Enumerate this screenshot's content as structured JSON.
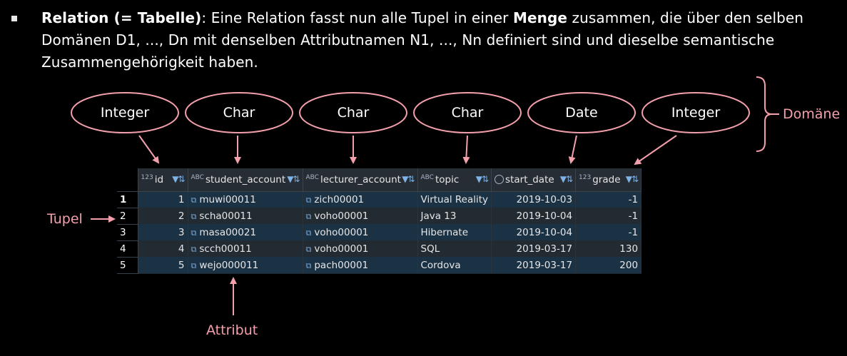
{
  "paragraph": {
    "term": "Relation (= Tabelle)",
    "text1": ": Eine Relation fasst nun alle Tupel in einer ",
    "menge": "Menge",
    "text2": " zusammen, die über den selben Domänen D1, ..., Dn mit denselben Attributnamen N1, ..., Nn definiert sind und dieselbe semantische Zusammengehörigkeit haben."
  },
  "domains": [
    "Integer",
    "Char",
    "Char",
    "Char",
    "Date",
    "Integer"
  ],
  "labels": {
    "domaene": "Domäne",
    "tupel": "Tupel",
    "attribut": "Attribut"
  },
  "icons": {
    "numeric_type": "123",
    "text_type": "ABC",
    "date_type": "clock-icon",
    "filter": "filter-sort-icon",
    "link": "external-link-icon"
  },
  "table": {
    "columns": [
      {
        "name": "id",
        "type": "123"
      },
      {
        "name": "student_account",
        "type": "ABC"
      },
      {
        "name": "lecturer_account",
        "type": "ABC"
      },
      {
        "name": "topic",
        "type": "ABC"
      },
      {
        "name": "start_date",
        "type": "date"
      },
      {
        "name": "grade",
        "type": "123"
      }
    ],
    "rows": [
      {
        "rownum": "1",
        "id": "1",
        "student_account": "muwi00011",
        "lecturer_account": "zich00001",
        "topic": "Virtual Reality",
        "start_date": "2019-10-03",
        "grade": "-1"
      },
      {
        "rownum": "2",
        "id": "2",
        "student_account": "scha00011",
        "lecturer_account": "voho00001",
        "topic": "Java 13",
        "start_date": "2019-10-04",
        "grade": "-1"
      },
      {
        "rownum": "3",
        "id": "3",
        "student_account": "masa00021",
        "lecturer_account": "voho00001",
        "topic": "Hibernate",
        "start_date": "2019-10-04",
        "grade": "-1"
      },
      {
        "rownum": "4",
        "id": "4",
        "student_account": "scch00011",
        "lecturer_account": "voho00001",
        "topic": "SQL",
        "start_date": "2019-03-17",
        "grade": "130"
      },
      {
        "rownum": "5",
        "id": "5",
        "student_account": "wejo000011",
        "lecturer_account": "pach00001",
        "topic": "Cordova",
        "start_date": "2019-03-17",
        "grade": "200"
      }
    ]
  },
  "colors": {
    "accent_pink": "#f4a0ac",
    "background": "#000000",
    "row_highlight": "#1b3144"
  }
}
